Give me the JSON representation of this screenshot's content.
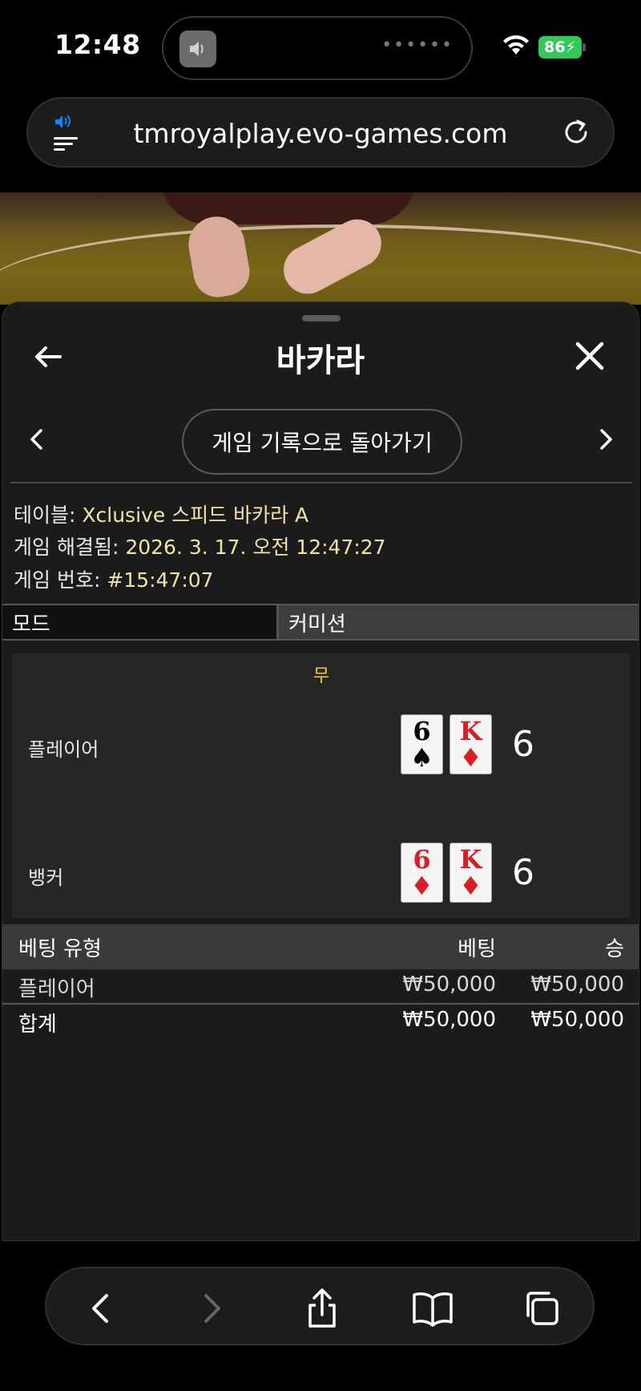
{
  "status_bar": {
    "time": "12:48",
    "battery": "86"
  },
  "browser": {
    "url": "tmroyalplay.evo-games.com"
  },
  "sheet": {
    "title": "바카라",
    "history_button": "게임 기록으로 돌아가기",
    "info": {
      "table_label": "테이블:",
      "table_value": "Xclusive 스피드 바카라 A",
      "resolved_label": "게임 해결됨:",
      "resolved_value": "2026. 3. 17. 오전 12:47:27",
      "number_label": "게임 번호:",
      "number_value": "#15:47:07"
    },
    "tabs": {
      "mode": "모드",
      "commission": "커미션"
    },
    "result": {
      "outcome": "무",
      "player": {
        "label": "플레이어",
        "cards": [
          {
            "rank": "6",
            "suit": "♠"
          },
          {
            "rank": "K",
            "suit": "♦"
          }
        ],
        "score": "6"
      },
      "banker": {
        "label": "뱅커",
        "cards": [
          {
            "rank": "6",
            "suit": "♦"
          },
          {
            "rank": "K",
            "suit": "♦"
          }
        ],
        "score": "6"
      }
    },
    "bets": {
      "headers": {
        "type": "베팅 유형",
        "bet": "베팅",
        "win": "승"
      },
      "rows": [
        {
          "type": "플레이어",
          "bet": "₩50,000",
          "win": "₩50,000"
        }
      ],
      "total": {
        "type": "합계",
        "bet": "₩50,000",
        "win": "₩50,000"
      }
    }
  },
  "colors": {
    "accent_text": "#f0e4a6",
    "tie": "#f2d02b",
    "battery": "#34c759",
    "link_blue": "#0a84ff"
  },
  "icons": [
    "speaker-icon",
    "wifi-icon",
    "reader-icon",
    "reload-icon",
    "back-arrow-icon",
    "close-icon",
    "chevron-left-icon",
    "chevron-right-icon",
    "share-icon",
    "bookmarks-icon",
    "tabs-icon"
  ]
}
